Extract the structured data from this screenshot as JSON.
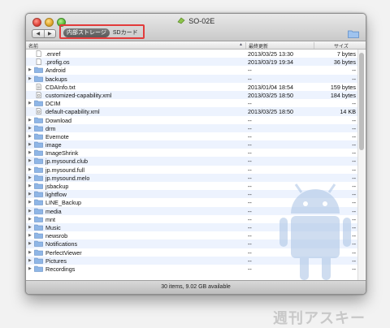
{
  "window": {
    "title": "SO-02E",
    "status": "30 items, 9.02 GB available"
  },
  "storage_tabs": [
    "内部ストレージ",
    "SDカード"
  ],
  "columns": {
    "name": "名前",
    "date": "最終更新",
    "size": "サイズ"
  },
  "rows": [
    {
      "name": ".enref",
      "date": "2013/03/25 13:30",
      "size": "7 bytes",
      "type": "file-icon",
      "expand": false
    },
    {
      "name": ".profig.os",
      "date": "2013/03/19 19:34",
      "size": "36 bytes",
      "type": "file-icon",
      "expand": false
    },
    {
      "name": "Android",
      "date": "--",
      "size": "--",
      "type": "folder-icon",
      "expand": true
    },
    {
      "name": "backups",
      "date": "--",
      "size": "--",
      "type": "folder-icon",
      "expand": true
    },
    {
      "name": "CDAInfo.txt",
      "date": "2013/01/04 18:54",
      "size": "159 bytes",
      "type": "text-file-icon",
      "expand": false
    },
    {
      "name": "customized-capability.xml",
      "date": "2013/03/25 18:50",
      "size": "184 bytes",
      "type": "xml-file-icon",
      "expand": false
    },
    {
      "name": "DCIM",
      "date": "--",
      "size": "--",
      "type": "folder-icon",
      "expand": true
    },
    {
      "name": "default-capability.xml",
      "date": "2013/03/25 18:50",
      "size": "14 KB",
      "type": "xml-file-icon",
      "expand": false
    },
    {
      "name": "Download",
      "date": "--",
      "size": "--",
      "type": "folder-icon",
      "expand": true
    },
    {
      "name": "drm",
      "date": "--",
      "size": "--",
      "type": "folder-icon",
      "expand": true
    },
    {
      "name": "Evernote",
      "date": "--",
      "size": "--",
      "type": "folder-icon",
      "expand": true
    },
    {
      "name": "image",
      "date": "--",
      "size": "--",
      "type": "folder-icon",
      "expand": true
    },
    {
      "name": "ImageShrink",
      "date": "--",
      "size": "--",
      "type": "folder-icon",
      "expand": true
    },
    {
      "name": "jp.mysound.club",
      "date": "--",
      "size": "--",
      "type": "folder-icon",
      "expand": true
    },
    {
      "name": "jp.mysound.full",
      "date": "--",
      "size": "--",
      "type": "folder-icon",
      "expand": true
    },
    {
      "name": "jp.mysound.melo",
      "date": "--",
      "size": "--",
      "type": "folder-icon",
      "expand": true
    },
    {
      "name": "jsbackup",
      "date": "--",
      "size": "--",
      "type": "folder-icon",
      "expand": true
    },
    {
      "name": "lightflow",
      "date": "--",
      "size": "--",
      "type": "folder-icon",
      "expand": true
    },
    {
      "name": "LINE_Backup",
      "date": "--",
      "size": "--",
      "type": "folder-icon",
      "expand": true
    },
    {
      "name": "media",
      "date": "--",
      "size": "--",
      "type": "folder-icon",
      "expand": true
    },
    {
      "name": "mnt",
      "date": "--",
      "size": "--",
      "type": "folder-icon",
      "expand": true
    },
    {
      "name": "Music",
      "date": "--",
      "size": "--",
      "type": "folder-icon",
      "expand": true
    },
    {
      "name": "newsrob",
      "date": "--",
      "size": "--",
      "type": "folder-icon",
      "expand": true
    },
    {
      "name": "Notifications",
      "date": "--",
      "size": "--",
      "type": "folder-icon",
      "expand": true
    },
    {
      "name": "PerfectViewer",
      "date": "--",
      "size": "--",
      "type": "folder-icon",
      "expand": true
    },
    {
      "name": "Pictures",
      "date": "--",
      "size": "--",
      "type": "folder-icon",
      "expand": true
    },
    {
      "name": "Recordings",
      "date": "--",
      "size": "--",
      "type": "folder-icon",
      "expand": true
    }
  ],
  "watermark": "週刊アスキー",
  "colors": {
    "highlight_border": "#e23b3b",
    "folder": "#8fb6e6",
    "row_alt": "#edf3fe"
  }
}
